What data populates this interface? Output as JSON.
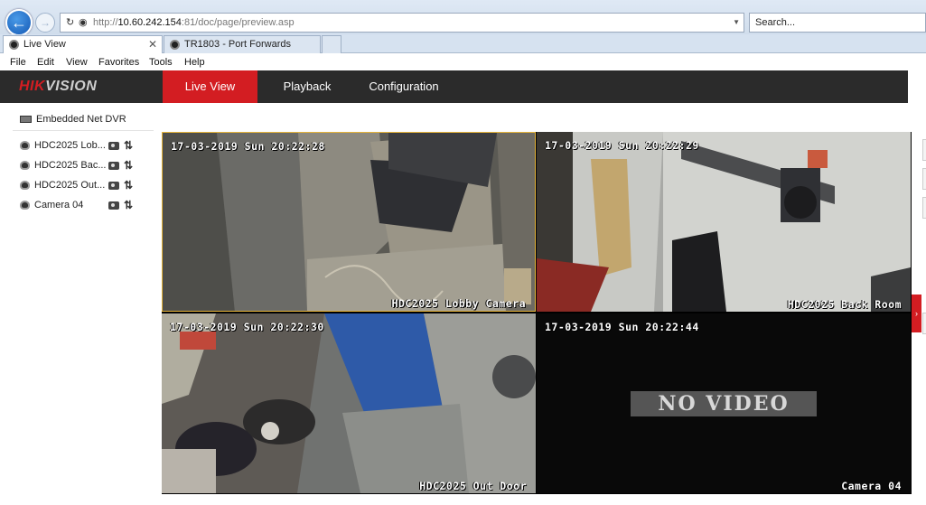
{
  "browser": {
    "url_prefix": "http://",
    "url_host": "10.60.242.154",
    "url_rest": ":81/doc/page/preview.asp",
    "search_placeholder": "Search...",
    "tabs": [
      {
        "label": "Live View",
        "active": true
      },
      {
        "label": "TR1803 - Port Forwards",
        "active": false
      }
    ],
    "menu": [
      "File",
      "Edit",
      "View",
      "Favorites",
      "Tools",
      "Help"
    ]
  },
  "header": {
    "logo_red": "HIK",
    "logo_rest": "VISION",
    "nav": [
      "Live View",
      "Playback",
      "Configuration"
    ],
    "active_nav": "Live View",
    "accent_color": "#d31d22",
    "bar_color": "#2b2b2b"
  },
  "tree": {
    "device": "Embedded Net DVR",
    "cameras": [
      {
        "label": "HDC2025 Lob...",
        "icon": "camera-icon"
      },
      {
        "label": "HDC2025 Bac...",
        "icon": "camera-icon"
      },
      {
        "label": "HDC2025 Out...",
        "icon": "camera-icon"
      },
      {
        "label": "Camera 04",
        "icon": "camera-icon"
      }
    ]
  },
  "video": {
    "tiles": [
      {
        "timestamp": "17-03-2019 Sun 20:22:28",
        "name": "HDC2025 Lobby Camera",
        "selected": true
      },
      {
        "timestamp": "17-03-2019 Sun 20:22:29",
        "name": "HDC2025 Back Room",
        "selected": false
      },
      {
        "timestamp": "17-03-2019 Sun 20:22:30",
        "name": "HDC2025 Out Door",
        "selected": false
      },
      {
        "timestamp": "17-03-2019 Sun 20:22:44",
        "name": "Camera 04",
        "selected": false,
        "status": "NO VIDEO"
      }
    ]
  }
}
